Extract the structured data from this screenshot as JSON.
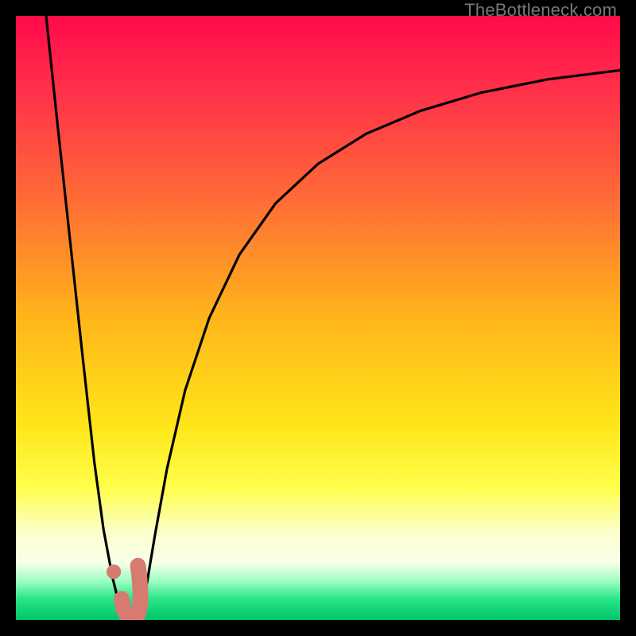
{
  "watermark": "TheBottleneck.com",
  "colors": {
    "bg_black": "#000000",
    "curve": "#000000",
    "marker_fill": "#d77a6f",
    "marker_stroke": "#d77a6f"
  },
  "chart_data": {
    "type": "line",
    "title": "",
    "xlabel": "",
    "ylabel": "",
    "xlim": [
      0,
      100
    ],
    "ylim": [
      0,
      100
    ],
    "grid": false,
    "gradient_stops": [
      {
        "pos": 0.0,
        "color": "#ff0a4b"
      },
      {
        "pos": 0.12,
        "color": "#ff2f4a"
      },
      {
        "pos": 0.3,
        "color": "#ff6a36"
      },
      {
        "pos": 0.5,
        "color": "#ffb51a"
      },
      {
        "pos": 0.68,
        "color": "#ffe61a"
      },
      {
        "pos": 0.78,
        "color": "#ffff4a"
      },
      {
        "pos": 0.86,
        "color": "#fbffd2"
      },
      {
        "pos": 0.905,
        "color": "#f7ffe8"
      },
      {
        "pos": 0.935,
        "color": "#9dffc3"
      },
      {
        "pos": 0.965,
        "color": "#29e588"
      },
      {
        "pos": 1.0,
        "color": "#00c46a"
      }
    ],
    "series": [
      {
        "name": "left-branch",
        "x": [
          5.0,
          7.0,
          9.0,
          11.0,
          13.0,
          14.5,
          16.0,
          17.0,
          17.8
        ],
        "y": [
          100.0,
          81.0,
          62.5,
          44.0,
          26.0,
          15.0,
          7.0,
          3.0,
          1.5
        ]
      },
      {
        "name": "right-branch",
        "x": [
          20.5,
          21.5,
          23.0,
          25.0,
          28.0,
          32.0,
          37.0,
          43.0,
          50.0,
          58.0,
          67.0,
          77.0,
          88.0,
          100.0
        ],
        "y": [
          1.5,
          5.0,
          14.0,
          25.0,
          38.0,
          50.0,
          60.5,
          69.0,
          75.5,
          80.5,
          84.3,
          87.3,
          89.5,
          91.0
        ]
      }
    ],
    "markers": {
      "dot": {
        "x": 16.2,
        "y": 8.0,
        "r": 1.2
      },
      "j_hook": {
        "points_x": [
          17.5,
          17.8,
          18.3,
          19.2,
          20.2,
          20.6,
          20.6,
          20.4,
          20.2
        ],
        "points_y": [
          3.5,
          1.8,
          0.9,
          0.6,
          1.0,
          2.5,
          5.0,
          7.5,
          9.0
        ],
        "width": 2.6
      }
    }
  }
}
